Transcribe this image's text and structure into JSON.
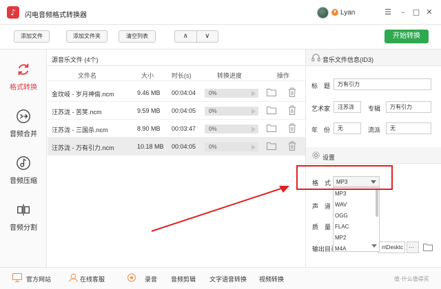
{
  "app": {
    "title": "闪电音频格式转换器",
    "user_name": "Lyan"
  },
  "toolbar": {
    "add_file": "添加文件",
    "add_folder": "添加文件夹",
    "clear_list": "清空列表",
    "move_up": "∧",
    "move_down": "∨",
    "start": "开始转换"
  },
  "sidebar": {
    "items": [
      {
        "label": "格式转换",
        "icon": "refresh-icon",
        "active": true
      },
      {
        "label": "音频合并",
        "icon": "merge-icon",
        "active": false
      },
      {
        "label": "音频压缩",
        "icon": "compress-icon",
        "active": false
      },
      {
        "label": "音频分割",
        "icon": "split-icon",
        "active": false
      }
    ]
  },
  "filelist": {
    "header": "源音乐文件 (4个)",
    "columns": [
      "文件名",
      "大小",
      "时长(s)",
      "转换进度",
      "操作"
    ],
    "rows": [
      {
        "name": "金玟岐 - 岁月神偷.ncm",
        "size": "9.46 MB",
        "duration": "00:04:04",
        "progress": "0%"
      },
      {
        "name": "汪苏泷 - 苦笑.ncm",
        "size": "9.59 MB",
        "duration": "00:04:05",
        "progress": "0%"
      },
      {
        "name": "汪苏泷 - 三国杀.ncm",
        "size": "8.90 MB",
        "duration": "00:03:47",
        "progress": "0%"
      },
      {
        "name": "汪苏泷 - 万有引力.ncm",
        "size": "10.18 MB",
        "duration": "00:04:05",
        "progress": "0%"
      }
    ]
  },
  "id3": {
    "title": "音乐文件信息(ID3)",
    "title_label": "标　题",
    "title_value": "万有引力",
    "artist_label": "艺术家",
    "artist_value": "汪苏泷",
    "album_label": "专辑",
    "album_value": "万有引力",
    "year_label": "年　份",
    "year_value": "无",
    "genre_label": "流派",
    "genre_value": "无"
  },
  "settings": {
    "title": "设置",
    "format_label": "格　式",
    "format_value": "MP3",
    "channel_label": "声　道",
    "quality_label": "质　量",
    "output_label": "输出目录",
    "output_value": "n\\Desktc",
    "browse": "···",
    "format_options": [
      "MP3",
      "WAV",
      "OGG",
      "FLAC",
      "MP2",
      "M4A"
    ]
  },
  "bottombar": {
    "items": [
      "官方网站",
      "在线客服",
      "录音",
      "音频剪辑",
      "文字语音转换",
      "视频转换"
    ],
    "watermark": "值·什么值得买"
  },
  "colors": {
    "accent": "#e2383e",
    "start": "#2fa84f",
    "highlight": "#e02020"
  }
}
